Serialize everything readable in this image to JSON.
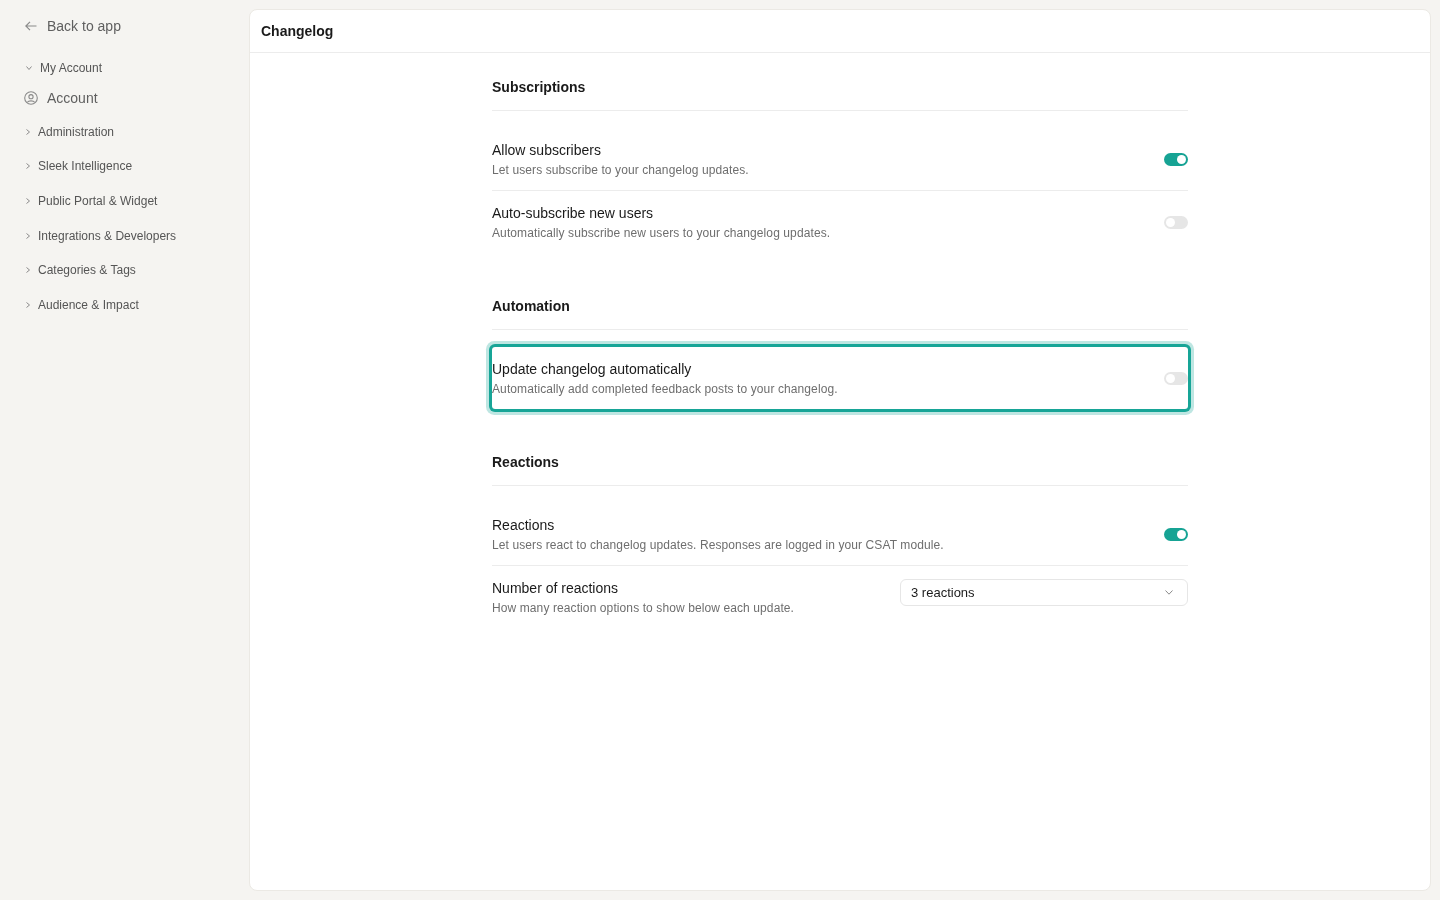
{
  "sidebar": {
    "back_link": "Back to app",
    "groups": [
      {
        "label": "My Account",
        "expanded": true,
        "items": [
          {
            "label": "Account"
          }
        ]
      },
      {
        "label": "Administration",
        "expanded": false
      },
      {
        "label": "Sleek Intelligence",
        "expanded": false
      },
      {
        "label": "Public Portal & Widget",
        "expanded": false
      },
      {
        "label": "Integrations & Developers",
        "expanded": false
      },
      {
        "label": "Categories & Tags",
        "expanded": false
      },
      {
        "label": "Audience & Impact",
        "expanded": false
      }
    ]
  },
  "header": {
    "title": "Changelog"
  },
  "sections": [
    {
      "title": "Subscriptions",
      "settings": [
        {
          "kind": "toggle",
          "title": "Allow subscribers",
          "description": "Let users subscribe to your changelog updates.",
          "on": true,
          "highlighted": false
        },
        {
          "kind": "toggle",
          "title": "Auto-subscribe new users",
          "description": "Automatically subscribe new users to your changelog updates.",
          "on": false,
          "highlighted": false
        }
      ]
    },
    {
      "title": "Automation",
      "settings": [
        {
          "kind": "toggle",
          "title": "Update changelog automatically",
          "description": "Automatically add completed feedback posts to your changelog.",
          "on": false,
          "highlighted": true
        }
      ]
    },
    {
      "title": "Reactions",
      "settings": [
        {
          "kind": "toggle",
          "title": "Reactions",
          "description": "Let users react to changelog updates. Responses are logged in your CSAT module.",
          "on": true,
          "highlighted": false
        },
        {
          "kind": "select",
          "title": "Number of reactions",
          "description": "How many reaction options to show below each update.",
          "value": "3 reactions",
          "highlighted": false
        }
      ]
    }
  ]
}
